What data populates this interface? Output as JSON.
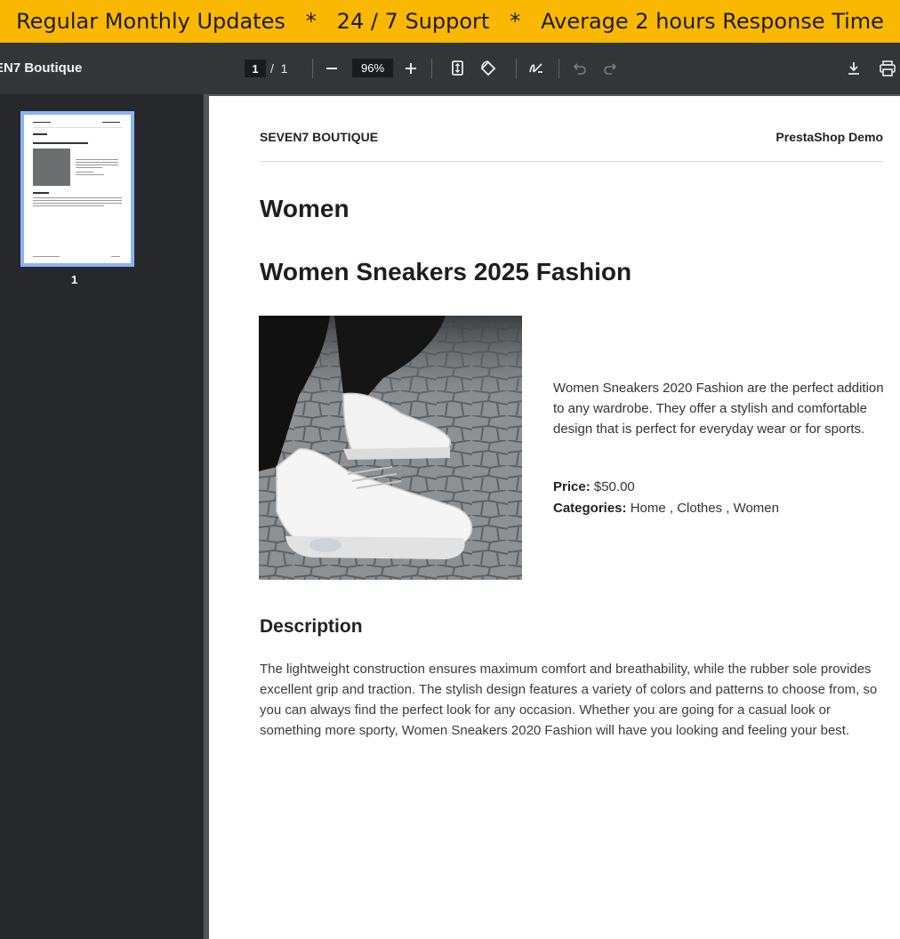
{
  "banner": {
    "text": "Regular Monthly Updates   *   24 / 7 Support   *   Average 2 hours Response Time"
  },
  "toolbar": {
    "title": "EN7 Boutique",
    "page_current": "1",
    "page_separator": "/",
    "page_total": "1",
    "zoom_value": "96%",
    "icons": [
      "minus-icon",
      "plus-icon",
      "fit-page-icon",
      "rotate-icon",
      "annotate-icon",
      "undo-icon",
      "redo-icon",
      "download-icon",
      "print-icon"
    ]
  },
  "sidebar": {
    "thumbnail_label": "1"
  },
  "document": {
    "header_left": "SEVEN7 BOUTIQUE",
    "header_right": "PrestaShop Demo",
    "category_title": "Women",
    "product_title": "Women Sneakers 2025 Fashion",
    "short_description": "Women Sneakers 2020 Fashion are the perfect addition to any wardrobe. They offer a stylish and comfortable design that is perfect for everyday wear or for sports.",
    "price_label": "Price:",
    "price_value": "$50.00",
    "categories_label": "Categories:",
    "categories_value": "Home , Clothes , Women",
    "description_title": "Description",
    "description_body": "The lightweight construction ensures maximum comfort and breathability, while the rubber sole provides excellent grip and traction. The stylish design features a variety of colors and patterns to choose from, so you can always find the perfect look for any occasion. Whether you are going for a casual look or something more sporty, Women Sneakers 2020 Fashion will have you looking and feeling your best."
  },
  "colors": {
    "banner_bg": "#fbb800",
    "toolbar_bg": "#323639",
    "sidebar_bg": "#27282b",
    "thumbnail_highlight": "#8ab4f8"
  }
}
